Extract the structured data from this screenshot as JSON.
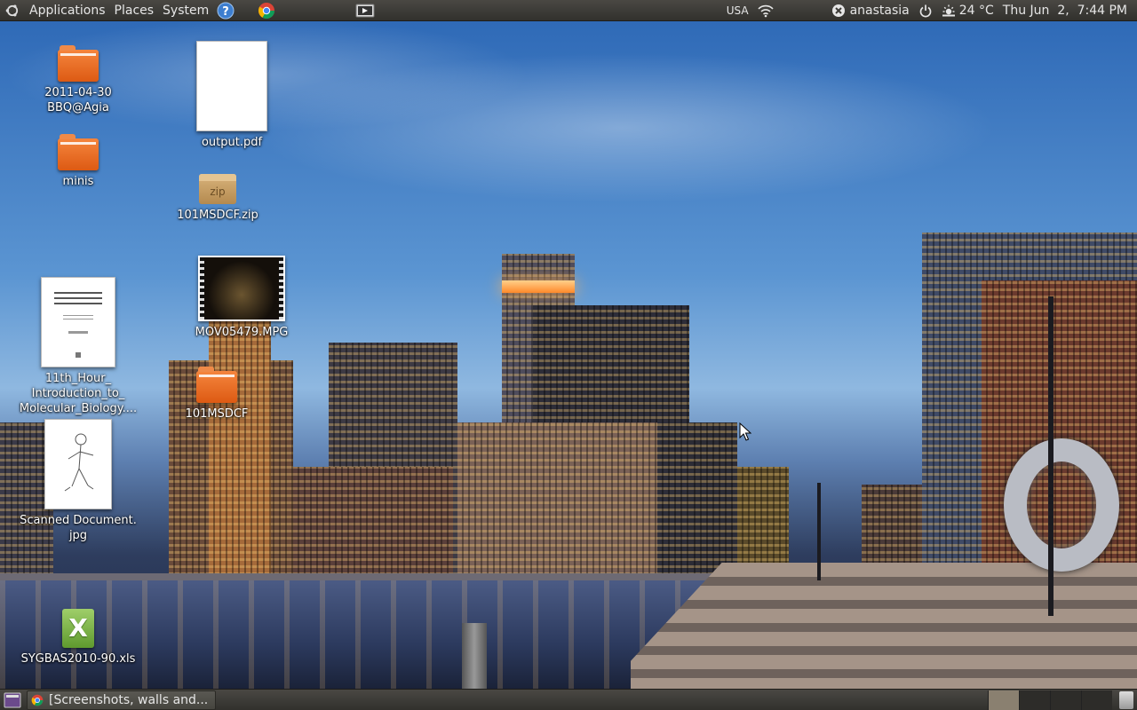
{
  "top_panel": {
    "menus": [
      "Applications",
      "Places",
      "System"
    ],
    "keyboard_layout": "USA",
    "user": "anastasia",
    "weather": "24 °C",
    "clock": "Thu Jun  2,  7:44 PM"
  },
  "desktop": {
    "icons": [
      {
        "label": "2011-04-30\nBBQ@Agia",
        "type": "folder"
      },
      {
        "label": "minis",
        "type": "folder"
      },
      {
        "label": "output.pdf",
        "type": "pdf"
      },
      {
        "label": "101MSDCF.zip",
        "type": "zip",
        "badge": "zip"
      },
      {
        "label": "MOV05479.MPG",
        "type": "video"
      },
      {
        "label": "11th_Hour_\nIntroduction_to_\nMolecular_Biology....",
        "type": "document"
      },
      {
        "label": "101MSDCF",
        "type": "folder"
      },
      {
        "label": "Scanned Document.\njpg",
        "type": "image"
      },
      {
        "label": "SYGBAS2010-90.xls",
        "type": "spreadsheet",
        "badge": "X"
      }
    ]
  },
  "bottom_panel": {
    "tasks": [
      {
        "label": "[Screenshots, walls and..."
      }
    ],
    "workspaces": 4,
    "active_workspace": 1
  },
  "colors": {
    "panel": "#3c3b37",
    "folder_orange": "#f07c2e",
    "ubuntu_help_blue": "#3d7ecf"
  }
}
